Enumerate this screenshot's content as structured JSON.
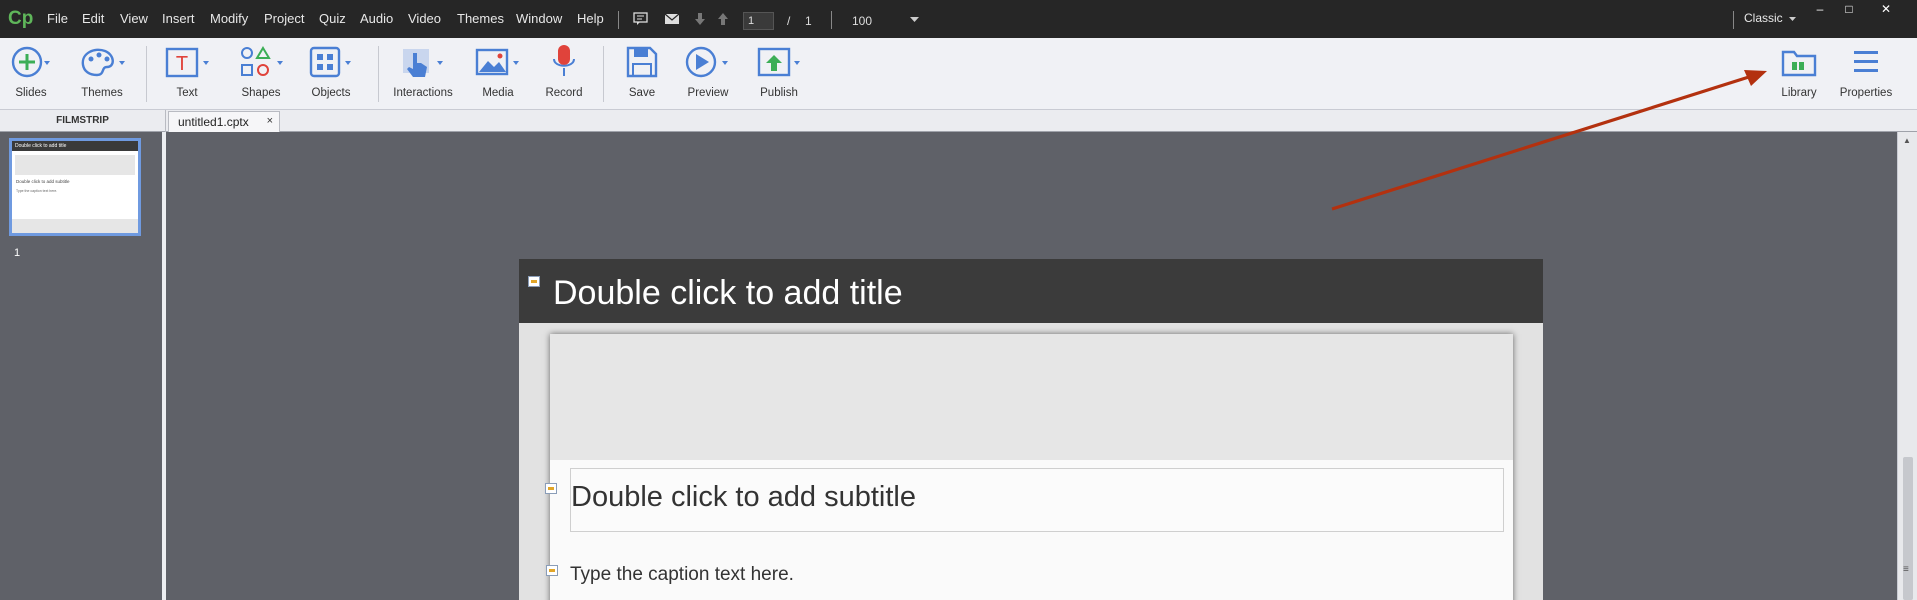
{
  "app": {
    "logo": "Cp"
  },
  "menu": [
    "File",
    "Edit",
    "View",
    "Insert",
    "Modify",
    "Project",
    "Quiz",
    "Audio",
    "Video",
    "Themes",
    "Window",
    "Help"
  ],
  "nav": {
    "current_slide": "1",
    "separator": "/",
    "total_slides": "1",
    "zoom": "100"
  },
  "workspace": {
    "label": "Classic"
  },
  "window_controls": {
    "minimize": "–",
    "maximize": "□",
    "close": "✕"
  },
  "toolbar": {
    "slides": "Slides",
    "themes": "Themes",
    "text": "Text",
    "shapes": "Shapes",
    "objects": "Objects",
    "interactions": "Interactions",
    "media": "Media",
    "record": "Record",
    "save": "Save",
    "preview": "Preview",
    "publish": "Publish",
    "library": "Library",
    "properties": "Properties"
  },
  "filmstrip": {
    "header": "FILMSTRIP",
    "slide_number": "1",
    "thumb_title": "Double click to add title",
    "thumb_subtitle": "Double click to add subtitle",
    "thumb_caption": "Type the caption text here."
  },
  "tab": {
    "label": "untitled1.cptx",
    "close": "×"
  },
  "slide": {
    "title": "Double click to add title",
    "subtitle": "Double click to add subtitle",
    "caption": "Type the caption text here."
  },
  "colors": {
    "accent_icon": "#4a7fd4",
    "record_red": "#e0433b",
    "annotation_arrow": "#b3310f",
    "title_bar": "#3b3b3b"
  }
}
